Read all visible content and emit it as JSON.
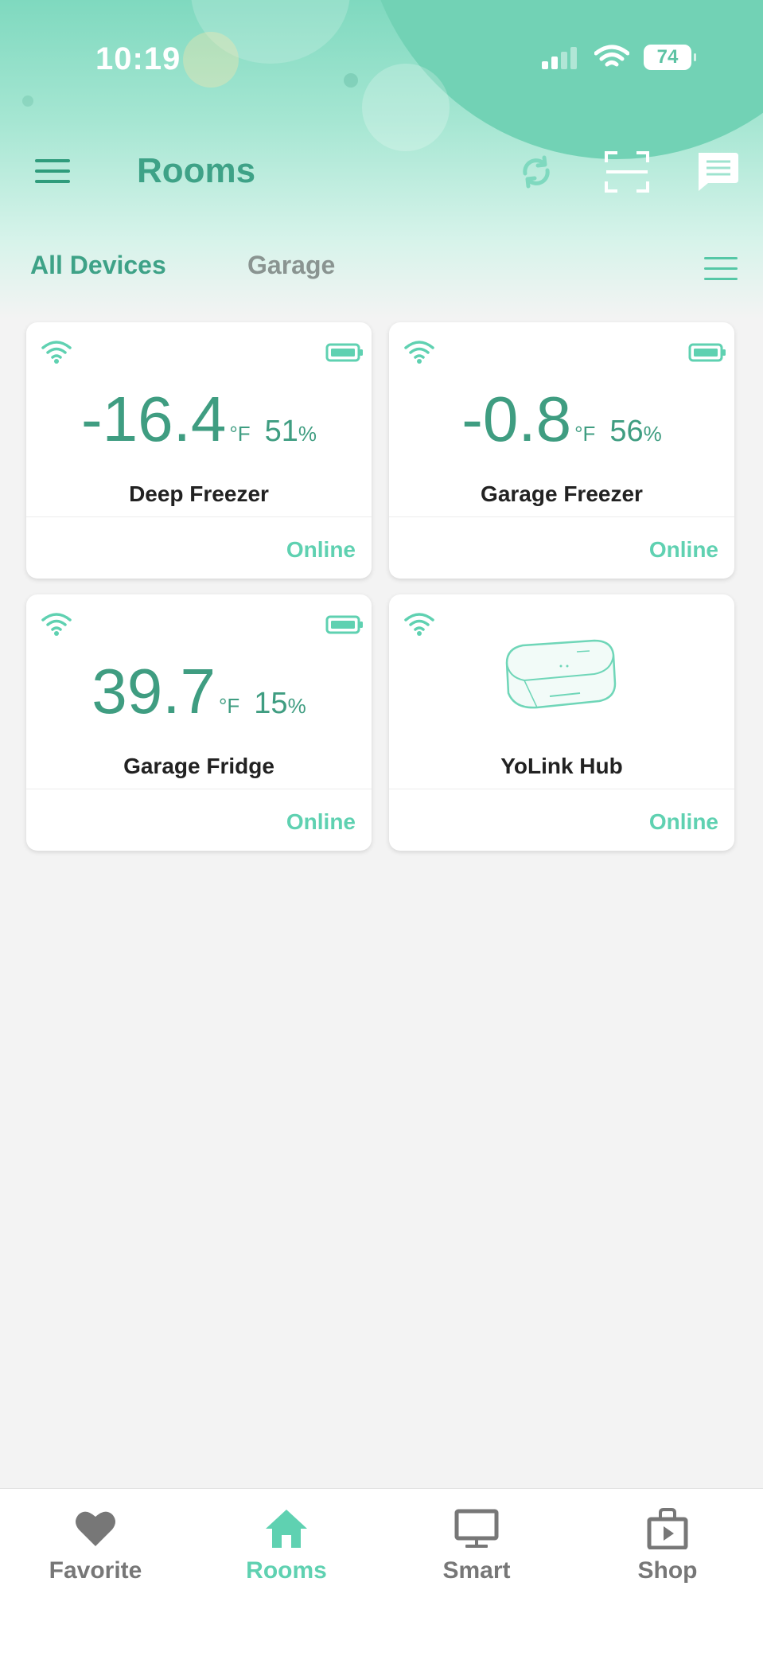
{
  "status_bar": {
    "time": "10:19",
    "battery": "74"
  },
  "header": {
    "title": "Rooms"
  },
  "tabs": [
    {
      "label": "All Devices"
    },
    {
      "label": "Garage"
    }
  ],
  "devices": [
    {
      "name": "Deep Freezer",
      "temp": "-16.4",
      "unit": "°F",
      "humidity": "51",
      "pct": "%",
      "status": "Online"
    },
    {
      "name": "Garage Freezer",
      "temp": "-0.8",
      "unit": "°F",
      "humidity": "56",
      "pct": "%",
      "status": "Online"
    },
    {
      "name": "Garage Fridge",
      "temp": "39.7",
      "unit": "°F",
      "humidity": "15",
      "pct": "%",
      "status": "Online"
    },
    {
      "name": "YoLink Hub",
      "status": "Online"
    }
  ],
  "nav": [
    {
      "label": "Favorite",
      "icon": "heart-icon"
    },
    {
      "label": "Rooms",
      "icon": "home-icon",
      "active": true
    },
    {
      "label": "Smart",
      "icon": "monitor-icon"
    },
    {
      "label": "Shop",
      "icon": "shop-bag-icon"
    }
  ],
  "colors": {
    "accent": "#3ea287",
    "online": "#5fd1b1",
    "inactive": "#777777"
  }
}
